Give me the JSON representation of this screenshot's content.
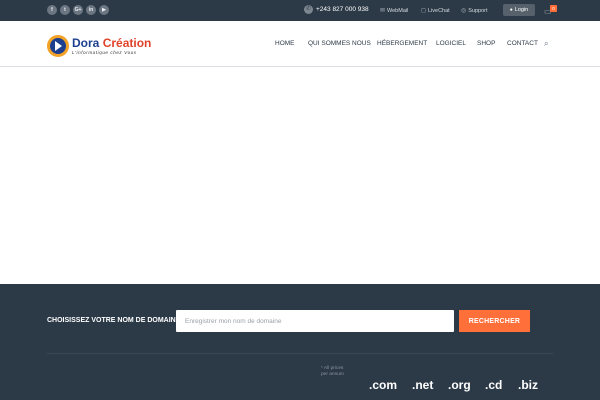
{
  "topbar": {
    "socials": [
      {
        "icon": "facebook-icon",
        "glyph": "f"
      },
      {
        "icon": "twitter-icon",
        "glyph": "t"
      },
      {
        "icon": "google-plus-icon",
        "glyph": "G+"
      },
      {
        "icon": "linkedin-icon",
        "glyph": "in"
      },
      {
        "icon": "youtube-icon",
        "glyph": "▶"
      }
    ],
    "phone": "+243 827 000 938",
    "webmail": "WebMail",
    "livechat": "LiveChat",
    "support": "Support",
    "login": "Login",
    "cart_count": "0"
  },
  "logo": {
    "title_part1": "Dora",
    "title_part2": "Création",
    "tagline": "L'informatique chez Vous"
  },
  "nav": {
    "items": [
      "HOME",
      "QUI SOMMES NOUS",
      "HÉBERGEMENT",
      "LOGICIEL",
      "SHOP",
      "CONTACT"
    ]
  },
  "domain": {
    "label": "CHOISISSEZ VOTRE NOM DE DOMAINE:",
    "placeholder": "Enregistrer mon nom de domaine",
    "button": "RECHERCHER",
    "price_note_1": "* All prices",
    "price_note_2": "per annum",
    "tlds": [
      ".com",
      ".net",
      ".org",
      ".cd",
      ".biz"
    ]
  },
  "colors": {
    "dark": "#2c3a47",
    "accent": "#ff6f3a",
    "brand_blue": "#1c3f8f",
    "brand_red": "#e0432a",
    "brand_gold": "#f2a227"
  }
}
